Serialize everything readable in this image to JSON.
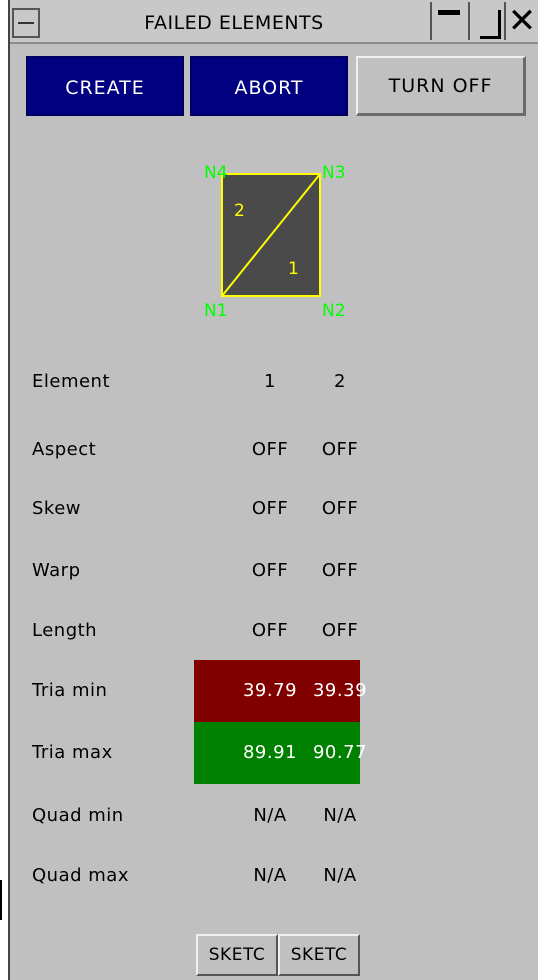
{
  "window": {
    "title": "FAILED ELEMENTS"
  },
  "toolbar": {
    "create_label": "CREATE",
    "abort_label": "ABORT",
    "turn_off_label": "TURN OFF"
  },
  "diagram": {
    "nodes": [
      "N1",
      "N2",
      "N3",
      "N4"
    ],
    "elements": [
      "1",
      "2"
    ],
    "colors": {
      "fill": "#4a4a4a",
      "edge": "#ffff00",
      "node_label": "#00ff00",
      "element_label": "#ffff00"
    }
  },
  "table": {
    "rows": [
      {
        "label": "Element",
        "v1": "1",
        "v2": "2"
      },
      {
        "label": "Aspect",
        "v1": "OFF",
        "v2": "OFF"
      },
      {
        "label": "Skew",
        "v1": "OFF",
        "v2": "OFF"
      },
      {
        "label": "Warp",
        "v1": "OFF",
        "v2": "OFF"
      },
      {
        "label": "Length",
        "v1": "OFF",
        "v2": "OFF"
      },
      {
        "label": "Tria min",
        "v1": "39.79",
        "v2": "39.39"
      },
      {
        "label": "Tria max",
        "v1": "89.91",
        "v2": "90.77"
      },
      {
        "label": "Quad min",
        "v1": "N/A",
        "v2": "N/A"
      },
      {
        "label": "Quad max",
        "v1": "N/A",
        "v2": "N/A"
      }
    ],
    "status_colors": {
      "fail": "#800000",
      "pass": "#008000"
    }
  },
  "sketch": {
    "button1_label": "SKETC",
    "button2_label": "SKETC"
  }
}
